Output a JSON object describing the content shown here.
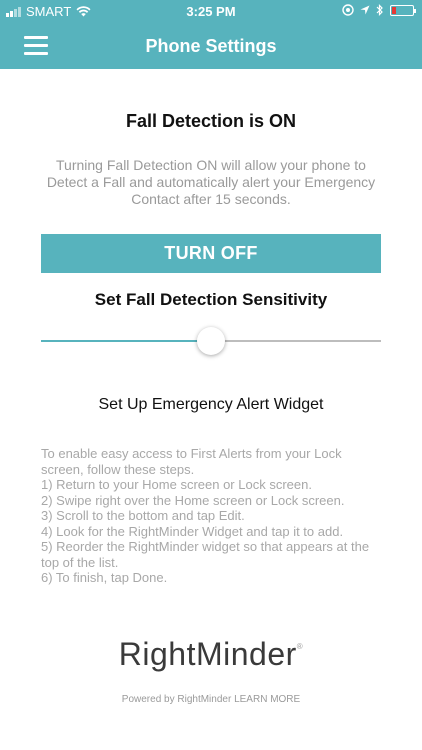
{
  "status_bar": {
    "carrier": "SMART",
    "time": "3:25 PM",
    "battery_color": "#e53935",
    "battery_level": 0.2,
    "icons": [
      "signal-icon",
      "wifi-icon",
      "location-lock-icon",
      "location-arrow-icon",
      "bluetooth-icon",
      "battery-icon"
    ]
  },
  "header": {
    "title": "Phone Settings",
    "menu_icon": "hamburger-menu-icon"
  },
  "fall_detection": {
    "title": "Fall Detection is ON",
    "description": "Turning Fall Detection ON will allow your phone to Detect a Fall and automatically alert your Emergency Contact after 15 seconds.",
    "button_label": "TURN OFF"
  },
  "sensitivity": {
    "title": "Set Fall Detection Sensitivity",
    "value": 0.5
  },
  "widget": {
    "title": "Set Up Emergency Alert Widget",
    "intro": "To enable easy access to First Alerts from your Lock screen, follow these steps.",
    "steps": [
      "1) Return to your Home screen or Lock screen.",
      "2) Swipe right over the Home screen or Lock screen.",
      "3) Scroll to the bottom and tap Edit.",
      "4) Look for the RightMinder Widget and tap it to add.",
      "5) Reorder the RightMinder widget so that appears at the top of the list.",
      "6) To finish, tap Done."
    ]
  },
  "logo": {
    "text": "RightMinder",
    "mark": "®"
  },
  "footer": {
    "powered_text": "Powered by RightMinder",
    "link_label": "LEARN MORE"
  },
  "colors": {
    "accent": "#57b3bd",
    "muted_text": "#9a9a9a"
  }
}
